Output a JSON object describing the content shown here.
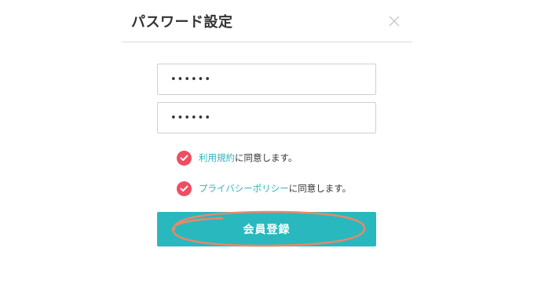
{
  "modal": {
    "title": "パスワード設定",
    "close_icon": "close-x-icon"
  },
  "form": {
    "password": "••••••",
    "password_confirm": "••••••"
  },
  "agreements": {
    "terms_link": "利用規約",
    "terms_suffix": "に同意します。",
    "privacy_link": "プライバシーポリシー",
    "privacy_suffix": "に同意します。",
    "check_icon": "check-icon",
    "check_color": "#ef4d63",
    "link_color": "#2db4bd"
  },
  "submit": {
    "label": "会員登録",
    "color": "#29b8be"
  },
  "annotation": {
    "shape": "hand-drawn-ellipse",
    "color": "#e58a6a"
  }
}
